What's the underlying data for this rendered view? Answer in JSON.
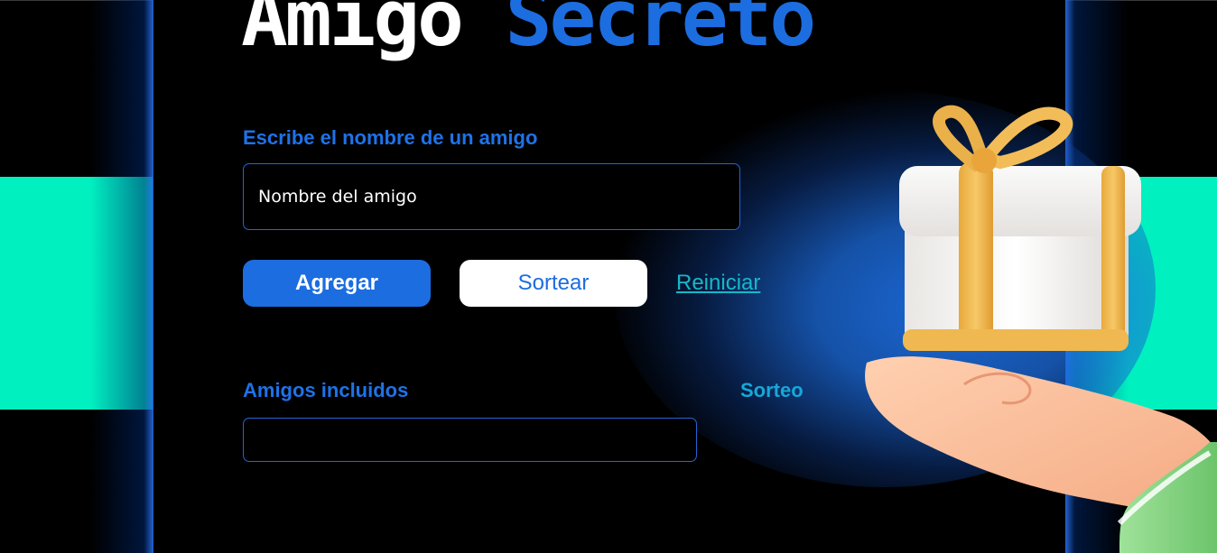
{
  "header": {
    "title_part1": "Amigo",
    "title_part2": "Secreto"
  },
  "form": {
    "input_label": "Escribe el nombre de un amigo",
    "input_placeholder": "Nombre del amigo",
    "add_button": "Agregar",
    "draw_button": "Sortear",
    "reset_link": "Reiniciar"
  },
  "lists": {
    "included_label": "Amigos incluidos",
    "result_label": "Sorteo",
    "included_items": [],
    "result_items": []
  },
  "illustration": {
    "icon": "gift-on-hand-icon"
  },
  "colors": {
    "accent_blue": "#1c6de0",
    "teal_band": "#00f0c0",
    "link_teal": "#16b8c8",
    "background": "#000000"
  }
}
